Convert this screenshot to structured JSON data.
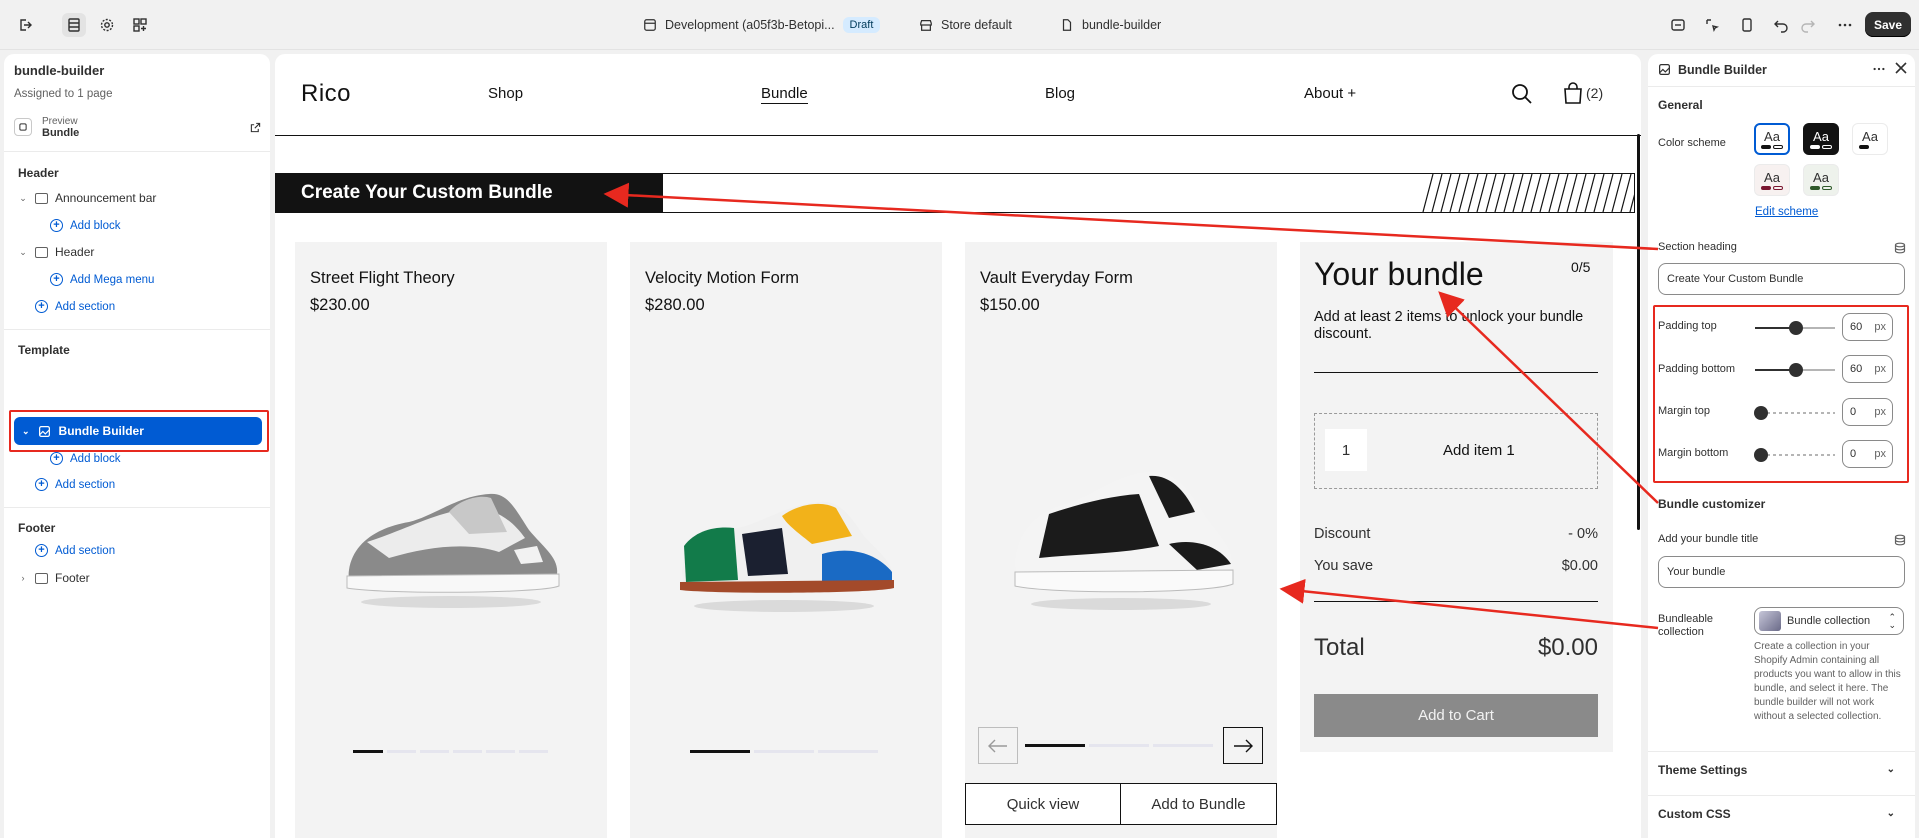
{
  "topbar": {
    "dev_label": "Development (a05f3b-Betopi...",
    "draft_badge": "Draft",
    "store_label": "Store default",
    "template_label": "bundle-builder",
    "save_label": "Save"
  },
  "left": {
    "title": "bundle-builder",
    "assigned": "Assigned to 1 page",
    "preview_label": "Preview",
    "preview_value": "Bundle",
    "header_group": "Header",
    "announcement": "Announcement bar",
    "add_block": "Add block",
    "header_item": "Header",
    "add_mega": "Add Mega menu",
    "add_section": "Add section",
    "template_group": "Template",
    "bundle_builder": "Bundle Builder",
    "footer_group": "Footer",
    "footer_item": "Footer"
  },
  "store": {
    "logo": "Rico",
    "nav": [
      "Shop",
      "Bundle",
      "Blog",
      "About +"
    ],
    "cart_count": "(2)",
    "heading": "Create Your Custom Bundle",
    "products": [
      {
        "title": "Street Flight Theory",
        "price": "$230.00"
      },
      {
        "title": "Velocity Motion Form",
        "price": "$280.00"
      },
      {
        "title": "Vault Everyday Form",
        "price": "$150.00"
      }
    ],
    "quick_view": "Quick view",
    "add_to_bundle": "Add to Bundle",
    "bundle": {
      "title": "Your bundle",
      "count": "0/5",
      "desc": "Add at least 2 items to unlock your bundle discount.",
      "slot_num": "1",
      "slot_label": "Add item 1",
      "discount_label": "Discount",
      "discount_value": "- 0%",
      "save_label": "You save",
      "save_value": "$0.00",
      "total_label": "Total",
      "total_value": "$0.00",
      "cta": "Add to Cart"
    }
  },
  "right": {
    "title": "Bundle Builder",
    "general": "General",
    "color_scheme": "Color scheme",
    "swatch_text": "Aa",
    "edit_scheme": "Edit scheme",
    "section_heading_label": "Section heading",
    "section_heading_value": "Create Your Custom Bundle",
    "padding_top": "Padding top",
    "padding_top_value": "60",
    "padding_bottom": "Padding bottom",
    "padding_bottom_value": "60",
    "margin_top": "Margin top",
    "margin_top_value": "0",
    "margin_bottom": "Margin bottom",
    "margin_bottom_value": "0",
    "unit": "px",
    "bundle_customizer": "Bundle customizer",
    "bundle_title_label": "Add your bundle title",
    "bundle_title_value": "Your bundle",
    "collection_label": "Bundleable collection",
    "collection_value": "Bundle collection",
    "collection_help": "Create a collection in your Shopify Admin containing all products you want to allow in this bundle, and select it here. The bundle builder will not work without a selected collection.",
    "theme_settings": "Theme Settings",
    "custom_css": "Custom CSS"
  },
  "colors": {
    "accent": "#005bd3",
    "annotation": "#e7291f",
    "dark": "#303030"
  }
}
